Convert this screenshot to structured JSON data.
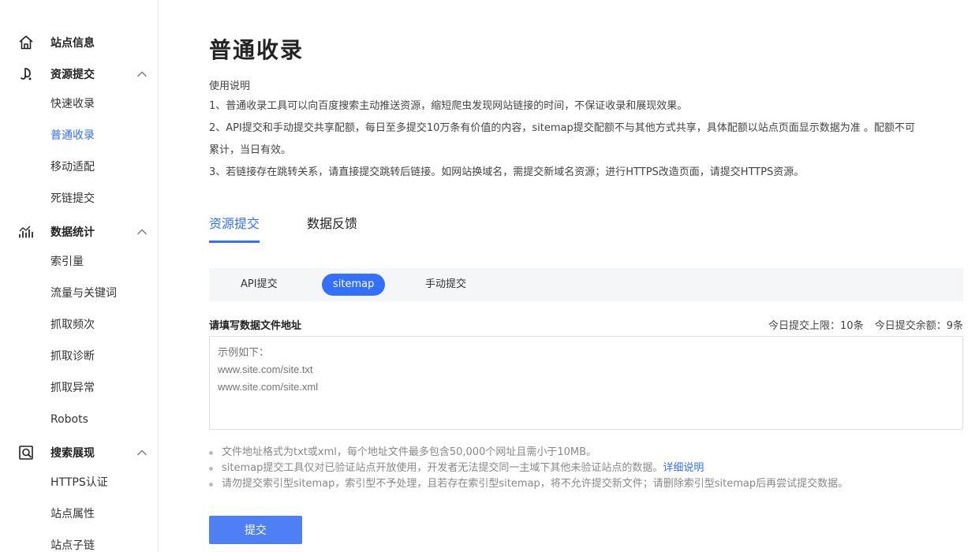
{
  "sidebar": {
    "groups": [
      {
        "label": "站点信息",
        "icon": "home-icon",
        "expanded": null
      },
      {
        "label": "资源提交",
        "icon": "submit-hook-icon",
        "expanded": true,
        "items": [
          "快速收录",
          "普通收录",
          "移动适配",
          "死链提交"
        ],
        "active_item": "普通收录"
      },
      {
        "label": "数据统计",
        "icon": "stats-icon",
        "expanded": true,
        "items": [
          "索引量",
          "流量与关键词",
          "抓取频次",
          "抓取诊断",
          "抓取异常",
          "Robots"
        ]
      },
      {
        "label": "搜索展现",
        "icon": "search-display-icon",
        "expanded": true,
        "items": [
          "HTTPS认证",
          "站点属性",
          "站点子链"
        ]
      }
    ]
  },
  "main": {
    "title": "普通收录",
    "usage": {
      "title": "使用说明",
      "lines": [
        "1、普通收录工具可以向百度搜索主动推送资源，缩短爬虫发现网站链接的时间，不保证收录和展现效果。",
        "2、API提交和手动提交共享配额，每日至多提交10万条有价值的内容，sitemap提交配额不与其他方式共享，具体配额以站点页面显示数据为准 。配额不可",
        "累计，当日有效。",
        "3、若链接存在跳转关系，请直接提交跳转后链接。如网站换域名，需提交新域名资源；进行HTTPS改造页面，请提交HTTPS资源。"
      ]
    },
    "tabs": [
      {
        "label": "资源提交",
        "active": true
      },
      {
        "label": "数据反馈",
        "active": false
      }
    ],
    "subtabs": [
      {
        "label": "API提交",
        "active": false
      },
      {
        "label": "sitemap",
        "active": true
      },
      {
        "label": "手动提交",
        "active": false
      }
    ],
    "field_label": "请填写数据文件地址",
    "quota": {
      "limit": "今日提交上限：10条",
      "remaining": "今日提交余额：9条"
    },
    "textarea_placeholder": "示例如下：\nwww.site.com/site.txt\nwww.site.com/site.xml",
    "notes": [
      {
        "text": "文件地址格式为txt或xml，每个地址文件最多包含50,000个网址且需小于10MB。"
      },
      {
        "text": "sitemap提交工具仅对已验证站点开放使用，开发者无法提交同一主域下其他未验证站点的数据。",
        "link": "详细说明"
      },
      {
        "text": "请勿提交索引型sitemap，索引型不予处理，且若存在索引型sitemap，将不允许提交新文件；请删除索引型sitemap后再尝试提交数据。"
      }
    ],
    "submit_label": "提交"
  },
  "colors": {
    "accent": "#3370ff",
    "submit": "#4e7ff5",
    "subtab_bg": "#f5f6f8"
  }
}
